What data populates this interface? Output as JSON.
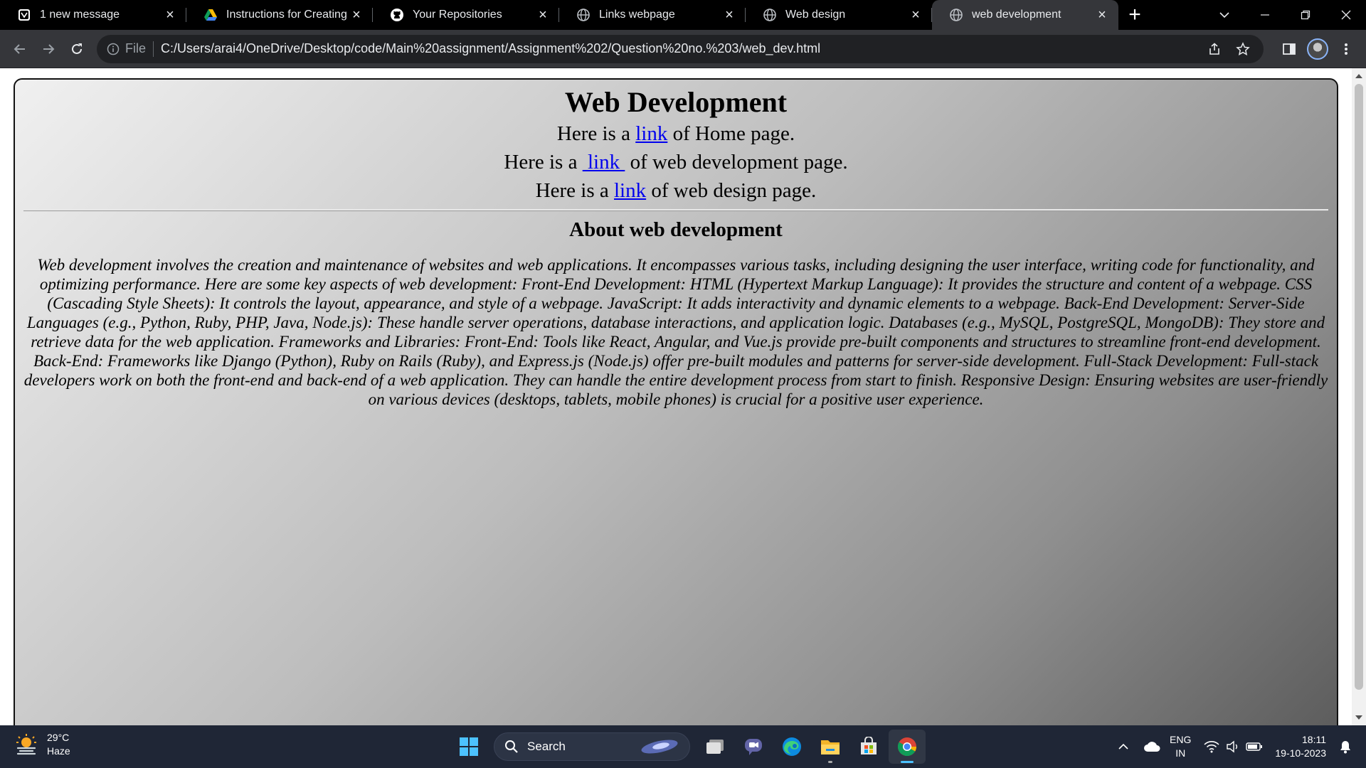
{
  "browser": {
    "tabs": [
      {
        "title": "1 new message",
        "favicon": "mail-icon",
        "active": false
      },
      {
        "title": "Instructions for Creating an",
        "favicon": "drive-icon",
        "active": false
      },
      {
        "title": "Your Repositories",
        "favicon": "github-icon",
        "active": false
      },
      {
        "title": "Links webpage",
        "favicon": "globe-icon",
        "active": false
      },
      {
        "title": "Web design",
        "favicon": "globe-icon",
        "active": false
      },
      {
        "title": "web development",
        "favicon": "globe-icon",
        "active": true
      }
    ],
    "omnibox": {
      "scheme_label": "File",
      "url": "C:/Users/arai4/OneDrive/Desktop/code/Main%20assignment/Assignment%202/Question%20no.%203/web_dev.html"
    }
  },
  "page": {
    "heading": "Web Development",
    "links": [
      {
        "prefix": "Here is a ",
        "link_text": "link",
        "suffix": " of Home page."
      },
      {
        "prefix": "Here is a ",
        "link_text": " link ",
        "suffix": " of web development page."
      },
      {
        "prefix": "Here is a ",
        "link_text": "link",
        "suffix": " of web design page."
      }
    ],
    "about_heading": "About web development",
    "about_text": "Web development involves the creation and maintenance of websites and web applications. It encompasses various tasks, including designing the user interface, writing code for functionality, and optimizing performance. Here are some key aspects of web development: Front-End Development: HTML (Hypertext Markup Language): It provides the structure and content of a webpage. CSS (Cascading Style Sheets): It controls the layout, appearance, and style of a webpage. JavaScript: It adds interactivity and dynamic elements to a webpage. Back-End Development: Server-Side Languages (e.g., Python, Ruby, PHP, Java, Node.js): These handle server operations, database interactions, and application logic. Databases (e.g., MySQL, PostgreSQL, MongoDB): They store and retrieve data for the web application. Frameworks and Libraries: Front-End: Tools like React, Angular, and Vue.js provide pre-built components and structures to streamline front-end development. Back-End: Frameworks like Django (Python), Ruby on Rails (Ruby), and Express.js (Node.js) offer pre-built modules and patterns for server-side development. Full-Stack Development: Full-stack developers work on both the front-end and back-end of a web application. They can handle the entire development process from start to finish. Responsive Design: Ensuring websites are user-friendly on various devices (desktops, tablets, mobile phones) is crucial for a positive user experience."
  },
  "taskbar": {
    "weather_temp": "29°C",
    "weather_desc": "Haze",
    "search_label": "Search",
    "lang_top": "ENG",
    "lang_bottom": "IN",
    "time": "18:11",
    "date": "19-10-2023"
  },
  "colors": {
    "tabstrip_bg": "#000000",
    "toolbar_bg": "#35363a",
    "omnibox_bg": "#202124",
    "link_color": "#0000ee",
    "taskbar_bg": "#1f2636",
    "accent": "#4cc2ff"
  }
}
